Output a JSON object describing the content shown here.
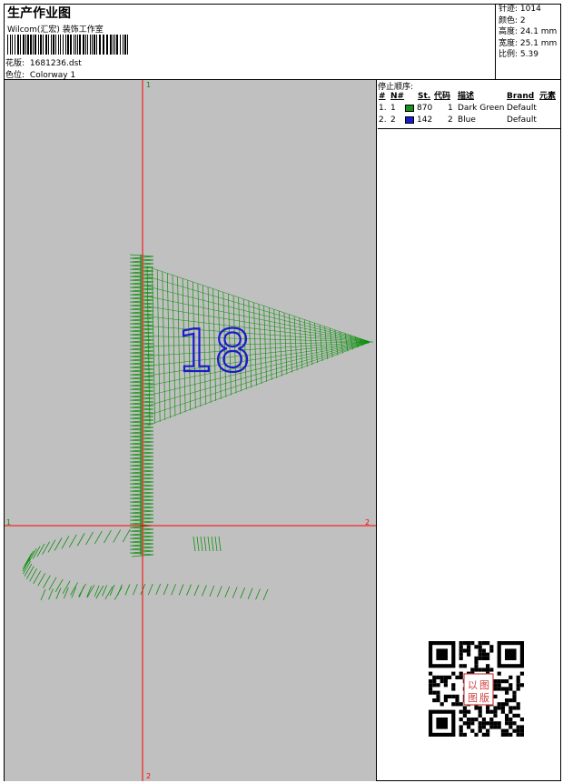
{
  "header": {
    "title": "生产作业图",
    "company": "Wilcom(汇宏) 装饰工作室",
    "design_label": "花版:",
    "design_file": "1681236.dst",
    "colorway_label": "色位:",
    "colorway_value": "Colorway 1"
  },
  "stats": {
    "stitches": "针迹: 1014",
    "colors": "颜色: 2",
    "height": "高度: 24.1 mm",
    "width": "宽度: 25.1 mm",
    "ratio": "比例: 5.39"
  },
  "canvas": {
    "marker_top": "1",
    "marker_bottom": "2",
    "marker_left": "1",
    "marker_right": "2",
    "design_text": "18",
    "colors": {
      "background": "#c0c0c0",
      "guide": "#ff0000",
      "green": "#0f8f0f",
      "blue": "#1a1acc"
    }
  },
  "stops": {
    "caption": "停止顺序:",
    "headers": [
      "#",
      "N#",
      "St.",
      "代码",
      "描述",
      "Brand",
      "元素"
    ],
    "rows": [
      {
        "num": "1.",
        "needle": "1",
        "color": "#1a8f1a",
        "stitches": "870",
        "code": "1",
        "desc": "Dark Green",
        "brand": "Default"
      },
      {
        "num": "2.",
        "needle": "2",
        "color": "#1a1acc",
        "stitches": "142",
        "code": "2",
        "desc": "Blue",
        "brand": "Default"
      }
    ]
  },
  "qr": {
    "stamp_text": [
      "以",
      "图",
      "图",
      "版"
    ]
  }
}
